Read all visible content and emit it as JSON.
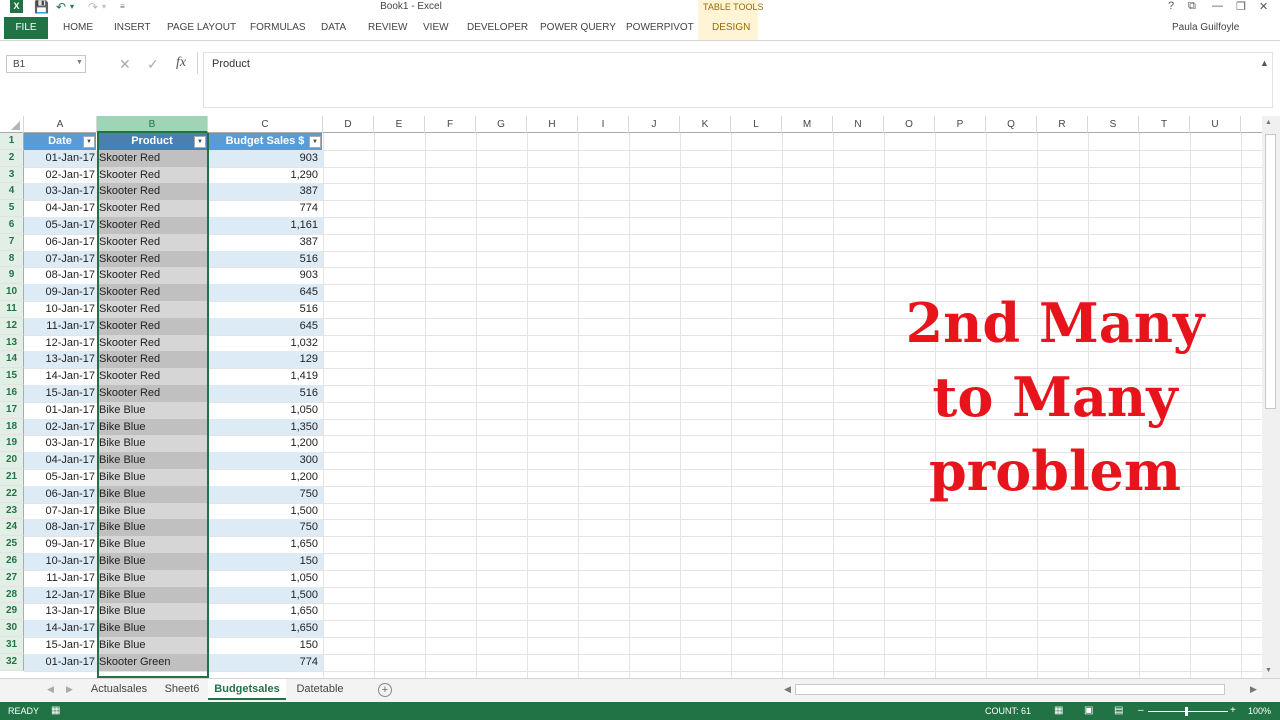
{
  "window": {
    "title": "Book1 - Excel",
    "logo": "X",
    "controls": [
      "?",
      "⧉",
      "—",
      "❐",
      "✕"
    ]
  },
  "quick_access": {
    "save_icon": "save-icon",
    "undo_icon": "undo-icon",
    "redo_icon": "redo-icon"
  },
  "ribbon": {
    "file": "FILE",
    "tabs": [
      "HOME",
      "INSERT",
      "PAGE LAYOUT",
      "FORMULAS",
      "DATA",
      "REVIEW",
      "VIEW",
      "DEVELOPER",
      "POWER QUERY",
      "POWERPIVOT",
      "DESIGN"
    ],
    "contextual_label": "TABLE TOOLS",
    "user": "Paula Guilfoyle"
  },
  "formula_bar": {
    "name_box": "B1",
    "formula": "Product"
  },
  "columns": [
    "A",
    "B",
    "C",
    "D",
    "E",
    "F",
    "G",
    "H",
    "I",
    "J",
    "K",
    "L",
    "M",
    "N",
    "O",
    "P",
    "Q",
    "R",
    "S",
    "T",
    "U"
  ],
  "table": {
    "headers": [
      "Date",
      "Product",
      "Budget Sales $"
    ],
    "rows": [
      [
        "01-Jan-17",
        "Skooter Red",
        "903"
      ],
      [
        "02-Jan-17",
        "Skooter Red",
        "1,290"
      ],
      [
        "03-Jan-17",
        "Skooter Red",
        "387"
      ],
      [
        "04-Jan-17",
        "Skooter Red",
        "774"
      ],
      [
        "05-Jan-17",
        "Skooter Red",
        "1,161"
      ],
      [
        "06-Jan-17",
        "Skooter Red",
        "387"
      ],
      [
        "07-Jan-17",
        "Skooter Red",
        "516"
      ],
      [
        "08-Jan-17",
        "Skooter Red",
        "903"
      ],
      [
        "09-Jan-17",
        "Skooter Red",
        "645"
      ],
      [
        "10-Jan-17",
        "Skooter Red",
        "516"
      ],
      [
        "11-Jan-17",
        "Skooter Red",
        "645"
      ],
      [
        "12-Jan-17",
        "Skooter Red",
        "1,032"
      ],
      [
        "13-Jan-17",
        "Skooter Red",
        "129"
      ],
      [
        "14-Jan-17",
        "Skooter Red",
        "1,419"
      ],
      [
        "15-Jan-17",
        "Skooter Red",
        "516"
      ],
      [
        "01-Jan-17",
        "Bike Blue",
        "1,050"
      ],
      [
        "02-Jan-17",
        "Bike Blue",
        "1,350"
      ],
      [
        "03-Jan-17",
        "Bike Blue",
        "1,200"
      ],
      [
        "04-Jan-17",
        "Bike Blue",
        "300"
      ],
      [
        "05-Jan-17",
        "Bike Blue",
        "1,200"
      ],
      [
        "06-Jan-17",
        "Bike Blue",
        "750"
      ],
      [
        "07-Jan-17",
        "Bike Blue",
        "1,500"
      ],
      [
        "08-Jan-17",
        "Bike Blue",
        "750"
      ],
      [
        "09-Jan-17",
        "Bike Blue",
        "1,650"
      ],
      [
        "10-Jan-17",
        "Bike Blue",
        "150"
      ],
      [
        "11-Jan-17",
        "Bike Blue",
        "1,050"
      ],
      [
        "12-Jan-17",
        "Bike Blue",
        "1,500"
      ],
      [
        "13-Jan-17",
        "Bike Blue",
        "1,650"
      ],
      [
        "14-Jan-17",
        "Bike Blue",
        "1,650"
      ],
      [
        "15-Jan-17",
        "Bike Blue",
        "150"
      ],
      [
        "01-Jan-17",
        "Skooter Green",
        "774"
      ]
    ]
  },
  "overlay_text": [
    "2nd Many",
    "to Many",
    "problem"
  ],
  "sheets": {
    "tabs": [
      "Actualsales",
      "Sheet6",
      "Budgetsales",
      "Datetable"
    ],
    "active": "Budgetsales"
  },
  "status": {
    "ready": "READY",
    "count": "COUNT: 61",
    "zoom": "100%"
  },
  "colors": {
    "excel_green": "#217346",
    "table_header": "#5b9bd5",
    "band": "#ddebf7",
    "overlay": "#e8141c"
  }
}
